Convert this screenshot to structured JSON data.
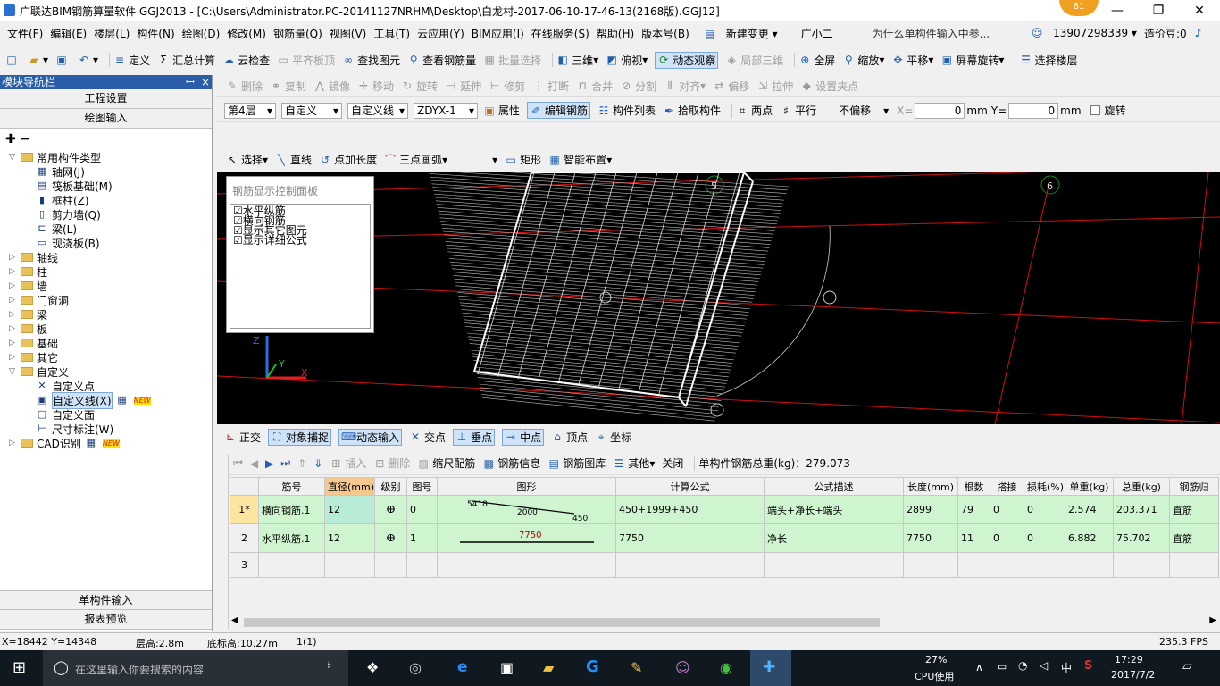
{
  "window": {
    "title": "广联达BIM钢筋算量软件 GGJ2013 - [C:\\Users\\Administrator.PC-20141127NRHM\\Desktop\\白龙村-2017-06-10-17-46-13(2168版).GGJ12]",
    "badge": "81",
    "minimize": "—",
    "restore": "❐",
    "close": "✕"
  },
  "menu": [
    "文件(F)",
    "编辑(E)",
    "楼层(L)",
    "构件(N)",
    "绘图(D)",
    "修改(M)",
    "钢筋量(Q)",
    "视图(V)",
    "工具(T)",
    "云应用(Y)",
    "BIM应用(I)",
    "在线服务(S)",
    "帮助(H)",
    "版本号(B)"
  ],
  "menu_extra": {
    "new_change": "新建变更",
    "user": "广小二",
    "question": "为什么单构件输入中参...",
    "phone": "13907298339",
    "price": "造价豆:0"
  },
  "toolbar1": [
    "定义",
    "汇总计算",
    "云检查",
    "平齐板顶",
    "查找图元",
    "查看钢筋量",
    "批量选择",
    "三维",
    "俯视",
    "动态观察",
    "局部三维",
    "全屏",
    "缩放",
    "平移",
    "屏幕旋转",
    "选择楼层"
  ],
  "toolbar2": [
    "删除",
    "复制",
    "镜像",
    "移动",
    "旋转",
    "延伸",
    "修剪",
    "打断",
    "合并",
    "分割",
    "对齐",
    "偏移",
    "拉伸",
    "设置夹点"
  ],
  "toolbar3": {
    "floor": "第4层",
    "type": "自定义",
    "subtype": "自定义线",
    "name": "ZDYX-1",
    "items": [
      "属性",
      "编辑钢筋",
      "构件列表",
      "拾取构件",
      "两点",
      "平行"
    ],
    "offset": "不偏移",
    "x_label": "X=",
    "x_value": "0",
    "y_label": "Y=",
    "y_value": "0",
    "unit": "mm",
    "rotate": "旋转"
  },
  "toolbar4": [
    "选择",
    "直线",
    "点加长度",
    "三点画弧",
    "矩形",
    "智能布置"
  ],
  "left_panel": {
    "header": "模块导航栏",
    "pin": "ꟷ",
    "close": "×",
    "btn_project": "工程设置",
    "btn_draw": "绘图输入",
    "tree": [
      {
        "label": "常用构件类型",
        "type": "folder",
        "expanded": true,
        "level": 0
      },
      {
        "label": "轴网(J)",
        "type": "item",
        "level": 1,
        "icon": "grid"
      },
      {
        "label": "筏板基础(M)",
        "type": "item",
        "level": 1,
        "icon": "raft"
      },
      {
        "label": "框柱(Z)",
        "type": "item",
        "level": 1,
        "icon": "column"
      },
      {
        "label": "剪力墙(Q)",
        "type": "item",
        "level": 1,
        "icon": "wall"
      },
      {
        "label": "梁(L)",
        "type": "item",
        "level": 1,
        "icon": "beam"
      },
      {
        "label": "现浇板(B)",
        "type": "item",
        "level": 1,
        "icon": "slab"
      },
      {
        "label": "轴线",
        "type": "folder",
        "level": 0
      },
      {
        "label": "柱",
        "type": "folder",
        "level": 0
      },
      {
        "label": "墙",
        "type": "folder",
        "level": 0
      },
      {
        "label": "门窗洞",
        "type": "folder",
        "level": 0
      },
      {
        "label": "梁",
        "type": "folder",
        "level": 0
      },
      {
        "label": "板",
        "type": "folder",
        "level": 0
      },
      {
        "label": "基础",
        "type": "folder",
        "level": 0
      },
      {
        "label": "其它",
        "type": "folder",
        "level": 0
      },
      {
        "label": "自定义",
        "type": "folder",
        "expanded": true,
        "level": 0
      },
      {
        "label": "自定义点",
        "type": "item",
        "level": 1,
        "icon": "point"
      },
      {
        "label": "自定义线(X)",
        "type": "item",
        "level": 1,
        "icon": "line",
        "selected": true,
        "new": "NEW"
      },
      {
        "label": "自定义面",
        "type": "item",
        "level": 1,
        "icon": "face"
      },
      {
        "label": "尺寸标注(W)",
        "type": "item",
        "level": 1,
        "icon": "dim"
      },
      {
        "label": "CAD识别",
        "type": "folder",
        "level": 0,
        "new": "NEW"
      }
    ],
    "btn_single": "单构件输入",
    "btn_report": "报表预览"
  },
  "rebar_panel": {
    "title": "钢筋显示控制面板",
    "options": [
      "水平纵筋",
      "横向钢筋",
      "显示其它图元",
      "显示详细公式"
    ]
  },
  "axis_labels": {
    "z": "Z",
    "y": "Y",
    "x": "X",
    "grid5": "5",
    "grid6": "6"
  },
  "snap_bar": [
    "正交",
    "对象捕捉",
    "动态输入",
    "交点",
    "垂点",
    "中点",
    "顶点",
    "坐标"
  ],
  "rebar_bar": {
    "items": [
      "插入",
      "删除",
      "缩尺配筋",
      "钢筋信息",
      "钢筋图库",
      "其他",
      "关闭"
    ],
    "total": "单构件钢筋总重(kg)：279.073"
  },
  "grid": {
    "headers": [
      "",
      "筋号",
      "直径(mm)",
      "级别",
      "图号",
      "图形",
      "计算公式",
      "公式描述",
      "长度(mm)",
      "根数",
      "搭接",
      "损耗(%)",
      "单重(kg)",
      "总重(kg)",
      "钢筋归"
    ],
    "rows": [
      {
        "no": "1*",
        "name": "横向钢筋.1",
        "dia": "12",
        "grade": "ⴲ",
        "fig": "0",
        "shape_a": "5418",
        "shape_b": "2000",
        "shape_c": "450",
        "formula": "450+1999+450",
        "desc": "端头+净长+端头",
        "length": "2899",
        "count": "79",
        "lap": "0",
        "loss": "0",
        "unit": "2.574",
        "total": "203.371",
        "type": "直筋"
      },
      {
        "no": "2",
        "name": "水平纵筋.1",
        "dia": "12",
        "grade": "ⴲ",
        "fig": "1",
        "shape_a": "7750",
        "shape_b": "",
        "shape_c": "",
        "formula": "7750",
        "desc": "净长",
        "length": "7750",
        "count": "11",
        "lap": "0",
        "loss": "0",
        "unit": "6.882",
        "total": "75.702",
        "type": "直筋"
      },
      {
        "no": "3",
        "name": "",
        "dia": "",
        "grade": "",
        "fig": "",
        "shape_a": "",
        "shape_b": "",
        "shape_c": "",
        "formula": "",
        "desc": "",
        "length": "",
        "count": "",
        "lap": "",
        "loss": "",
        "unit": "",
        "total": "",
        "type": ""
      }
    ]
  },
  "status": {
    "coords": "X=18442 Y=14348",
    "floor_h": "层高:2.8m",
    "base_h": "底标高:10.27m",
    "count": "1(1)",
    "fps": "235.3 FPS"
  },
  "taskbar": {
    "search": "在这里输入你要搜索的内容",
    "cpu_pct": "27%",
    "cpu_label": "CPU使用",
    "ime": "中",
    "time": "17:29",
    "date": "2017/7/2"
  },
  "colors": {
    "accent": "#2b5ea8",
    "grid_green": "#cff5d0",
    "canvas": "#000000",
    "red_line": "#d01010"
  }
}
